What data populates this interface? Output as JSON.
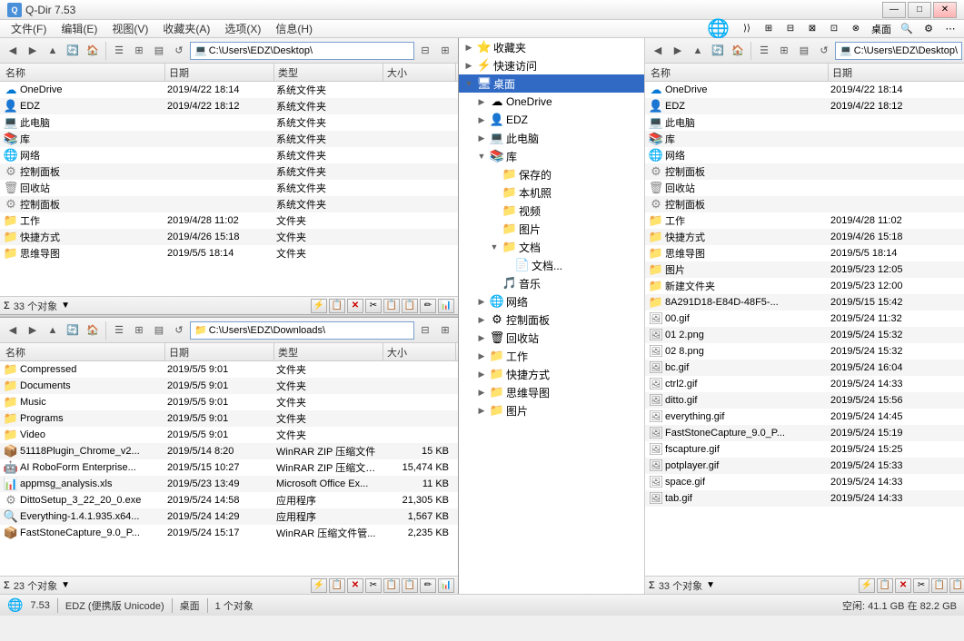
{
  "app": {
    "title": "Q-Dir 7.53",
    "icon": "Q"
  },
  "title_buttons": [
    "—",
    "□",
    "✕"
  ],
  "menu": {
    "items": [
      "文件(F)",
      "编辑(E)",
      "视图(V)",
      "收藏夹(A)",
      "选项(X)",
      "信息(H)"
    ]
  },
  "pane1": {
    "address": "C:\\Users\\EDZ\\Desktop\\",
    "object_count": "33 个对象",
    "columns": [
      "名称",
      "日期",
      "类型",
      "大小"
    ],
    "files": [
      {
        "icon": "☁",
        "name": "OneDrive",
        "date": "2019/4/22 18:14",
        "type": "系统文件夹",
        "size": "",
        "color": "#0078d4"
      },
      {
        "icon": "👤",
        "name": "EDZ",
        "date": "2019/4/22 18:12",
        "type": "系统文件夹",
        "size": "",
        "color": "#4a90d9"
      },
      {
        "icon": "💻",
        "name": "此电脑",
        "date": "",
        "type": "系统文件夹",
        "size": "",
        "color": "#888"
      },
      {
        "icon": "📚",
        "name": "库",
        "date": "",
        "type": "系统文件夹",
        "size": "",
        "color": "#888"
      },
      {
        "icon": "🌐",
        "name": "网络",
        "date": "",
        "type": "系统文件夹",
        "size": "",
        "color": "#888"
      },
      {
        "icon": "⚙",
        "name": "控制面板",
        "date": "",
        "type": "系统文件夹",
        "size": "",
        "color": "#888"
      },
      {
        "icon": "🗑",
        "name": "回收站",
        "date": "",
        "type": "系统文件夹",
        "size": "",
        "color": "#888"
      },
      {
        "icon": "⚙",
        "name": "控制面板",
        "date": "",
        "type": "系统文件夹",
        "size": "",
        "color": "#888"
      },
      {
        "icon": "📁",
        "name": "工作",
        "date": "2019/4/28 11:02",
        "type": "文件夹",
        "size": "",
        "color": "#f5c518"
      },
      {
        "icon": "📁",
        "name": "快捷方式",
        "date": "2019/4/26 15:18",
        "type": "文件夹",
        "size": "",
        "color": "#f5c518"
      },
      {
        "icon": "📁",
        "name": "思维导图",
        "date": "2019/5/5 18:14",
        "type": "文件夹",
        "size": "",
        "color": "#f5c518"
      }
    ]
  },
  "pane2": {
    "address": "C:\\Users\\EDZ\\Downloads\\",
    "object_count": "23 个对象",
    "columns": [
      "名称",
      "日期",
      "类型",
      "大小"
    ],
    "files": [
      {
        "icon": "📁",
        "name": "Compressed",
        "date": "2019/5/5 9:01",
        "type": "文件夹",
        "size": "",
        "color": "#f5c518"
      },
      {
        "icon": "📁",
        "name": "Documents",
        "date": "2019/5/5 9:01",
        "type": "文件夹",
        "size": "",
        "color": "#f5c518"
      },
      {
        "icon": "📁",
        "name": "Music",
        "date": "2019/5/5 9:01",
        "type": "文件夹",
        "size": "",
        "color": "#f5c518"
      },
      {
        "icon": "📁",
        "name": "Programs",
        "date": "2019/5/5 9:01",
        "type": "文件夹",
        "size": "",
        "color": "#f5c518"
      },
      {
        "icon": "📁",
        "name": "Video",
        "date": "2019/5/5 9:01",
        "type": "文件夹",
        "size": "",
        "color": "#f5c518"
      },
      {
        "icon": "📦",
        "name": "51118Plugin_Chrome_v2...",
        "date": "2019/5/14 8:20",
        "type": "WinRAR ZIP 压缩文件",
        "size": "15 KB",
        "color": "#cc0000"
      },
      {
        "icon": "🤖",
        "name": "AI RoboForm Enterprise...",
        "date": "2019/5/15 10:27",
        "type": "WinRAR ZIP 压缩文件管...",
        "size": "15,474 KB",
        "color": "#4a90d9"
      },
      {
        "icon": "📊",
        "name": "appmsg_analysis.xls",
        "date": "2019/5/23 13:49",
        "type": "Microsoft Office Ex...",
        "size": "11 KB",
        "color": "#1d7a43"
      },
      {
        "icon": "⚙",
        "name": "DittoSetup_3_22_20_0.exe",
        "date": "2019/5/24 14:58",
        "type": "应用程序",
        "size": "21,305 KB",
        "color": "#888"
      },
      {
        "icon": "🔍",
        "name": "Everything-1.4.1.935.x64...",
        "date": "2019/5/24 14:29",
        "type": "应用程序",
        "size": "1,567 KB",
        "color": "#4a4a8a"
      },
      {
        "icon": "📦",
        "name": "FastStoneCapture_9.0_P...",
        "date": "2019/5/24 15:17",
        "type": "WinRAR 压缩文件管...",
        "size": "2,235 KB",
        "color": "#cc0000"
      }
    ]
  },
  "tree": {
    "items": [
      {
        "label": "收藏夹",
        "icon": "⭐",
        "level": 0,
        "expanded": false
      },
      {
        "label": "快速访问",
        "icon": "⚡",
        "level": 0,
        "expanded": false
      },
      {
        "label": "桌面",
        "icon": "🖥",
        "level": 0,
        "expanded": true,
        "selected": true
      },
      {
        "label": "OneDrive",
        "icon": "☁",
        "level": 1,
        "expanded": false
      },
      {
        "label": "EDZ",
        "icon": "👤",
        "level": 1,
        "expanded": false
      },
      {
        "label": "此电脑",
        "icon": "💻",
        "level": 1,
        "expanded": false
      },
      {
        "label": "库",
        "icon": "📚",
        "level": 1,
        "expanded": true
      },
      {
        "label": "保存的",
        "icon": "📁",
        "level": 2,
        "expanded": false
      },
      {
        "label": "本机照",
        "icon": "📁",
        "level": 2,
        "expanded": false
      },
      {
        "label": "视频",
        "icon": "📁",
        "level": 2,
        "expanded": false
      },
      {
        "label": "图片",
        "icon": "📁",
        "level": 2,
        "expanded": false
      },
      {
        "label": "文档",
        "icon": "📁",
        "level": 2,
        "expanded": true
      },
      {
        "label": "文档...",
        "icon": "📄",
        "level": 3,
        "expanded": false
      },
      {
        "label": "音乐",
        "icon": "🎵",
        "level": 2,
        "expanded": false
      },
      {
        "label": "网络",
        "icon": "🌐",
        "level": 1,
        "expanded": false
      },
      {
        "label": "控制面板",
        "icon": "⚙",
        "level": 1,
        "expanded": false
      },
      {
        "label": "回收站",
        "icon": "🗑",
        "level": 1,
        "expanded": false
      },
      {
        "label": "工作",
        "icon": "📁",
        "level": 1,
        "expanded": false
      },
      {
        "label": "快捷方式",
        "icon": "📁",
        "level": 1,
        "expanded": false
      },
      {
        "label": "思维导图",
        "icon": "📁",
        "level": 1,
        "expanded": false
      },
      {
        "label": "图片",
        "icon": "📁",
        "level": 1,
        "expanded": false
      }
    ]
  },
  "pane3": {
    "address": "C:\\Users\\EDZ\\Desktop\\",
    "object_count": "33 个对象",
    "columns": [
      "名称",
      "日期"
    ],
    "files": [
      {
        "icon": "☁",
        "name": "OneDrive",
        "date": "2019/4/22 18:14",
        "color": "#0078d4"
      },
      {
        "icon": "👤",
        "name": "EDZ",
        "date": "2019/4/22 18:12",
        "color": "#4a90d9"
      },
      {
        "icon": "💻",
        "name": "此电脑",
        "date": "",
        "color": "#888"
      },
      {
        "icon": "📚",
        "name": "库",
        "date": "",
        "color": "#888"
      },
      {
        "icon": "🌐",
        "name": "网络",
        "date": "",
        "color": "#888"
      },
      {
        "icon": "⚙",
        "name": "控制面板",
        "date": "",
        "color": "#888"
      },
      {
        "icon": "🗑",
        "name": "回收站",
        "date": "",
        "color": "#888"
      },
      {
        "icon": "⚙",
        "name": "控制面板",
        "date": "",
        "color": "#888"
      },
      {
        "icon": "📁",
        "name": "工作",
        "date": "2019/4/28 11:02",
        "color": "#f5c518"
      },
      {
        "icon": "📁",
        "name": "快捷方式",
        "date": "2019/4/26 15:18",
        "color": "#f5c518"
      },
      {
        "icon": "📁",
        "name": "思维导图",
        "date": "2019/5/5 18:14",
        "color": "#f5c518"
      },
      {
        "icon": "📁",
        "name": "图片",
        "date": "2019/5/23 12:05",
        "color": "#f5c518"
      },
      {
        "icon": "📁",
        "name": "新建文件夹",
        "date": "2019/5/23 12:00",
        "color": "#f5c518"
      },
      {
        "icon": "📁",
        "name": "8A291D18-E84D-48F5-...",
        "date": "2019/5/15 15:42",
        "color": "#f5c518"
      },
      {
        "icon": "🖼",
        "name": "00.gif",
        "date": "2019/5/24 11:32",
        "color": "#888"
      },
      {
        "icon": "🖼",
        "name": "01 2.png",
        "date": "2019/5/24 15:32",
        "color": "#888"
      },
      {
        "icon": "🖼",
        "name": "02 8.png",
        "date": "2019/5/24 15:32",
        "color": "#888"
      },
      {
        "icon": "🖼",
        "name": "bc.gif",
        "date": "2019/5/24 16:04",
        "color": "#888"
      },
      {
        "icon": "🖼",
        "name": "ctrl2.gif",
        "date": "2019/5/24 14:33",
        "color": "#888"
      },
      {
        "icon": "🖼",
        "name": "ditto.gif",
        "date": "2019/5/24 15:56",
        "color": "#888"
      },
      {
        "icon": "🖼",
        "name": "everything.gif",
        "date": "2019/5/24 14:45",
        "color": "#888"
      },
      {
        "icon": "🖼",
        "name": "FastStoneCapture_9.0_P...",
        "date": "2019/5/24 15:19",
        "color": "#888"
      },
      {
        "icon": "🖼",
        "name": "fscapture.gif",
        "date": "2019/5/24 15:25",
        "color": "#888"
      },
      {
        "icon": "🖼",
        "name": "potplayer.gif",
        "date": "2019/5/24 15:33",
        "color": "#888"
      },
      {
        "icon": "🖼",
        "name": "space.gif",
        "date": "2019/5/24 14:33",
        "color": "#888"
      },
      {
        "icon": "🖼",
        "name": "tab.gif",
        "date": "2019/5/24 14:33",
        "color": "#888"
      }
    ]
  },
  "status_bar": {
    "version": "7.53",
    "user": "EDZ (便携版 Unicode)",
    "location": "桌面",
    "free_space": "空闲: 41.1 GB 在 82.2 GB"
  },
  "bottom_status": "1 个对象"
}
